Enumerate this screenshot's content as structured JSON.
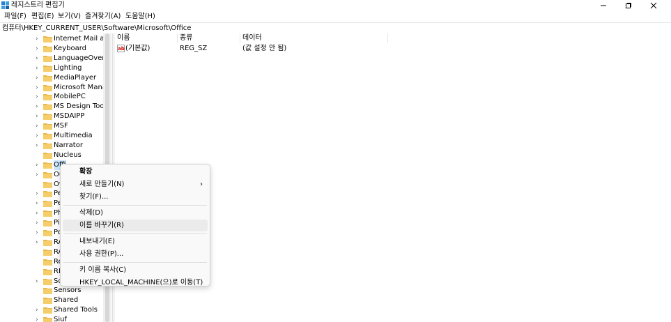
{
  "window": {
    "title": "레지스트리 편집기"
  },
  "menubar": [
    "파일(F)",
    "편집(E)",
    "보기(V)",
    "즐겨찾기(A)",
    "도움말(H)"
  ],
  "address": "컴퓨터\\HKEY_CURRENT_USER\\Software\\Microsoft\\Office",
  "tree": [
    {
      "label": "Internet Mail and",
      "expandable": true
    },
    {
      "label": "Keyboard",
      "expandable": true
    },
    {
      "label": "LanguageOverlay",
      "expandable": true
    },
    {
      "label": "Lighting",
      "expandable": true
    },
    {
      "label": "MediaPlayer",
      "expandable": true
    },
    {
      "label": "Microsoft Manage",
      "expandable": true
    },
    {
      "label": "MobilePC",
      "expandable": true
    },
    {
      "label": "MS Design Tools",
      "expandable": true
    },
    {
      "label": "MSDAIPP",
      "expandable": true
    },
    {
      "label": "MSF",
      "expandable": true
    },
    {
      "label": "Multimedia",
      "expandable": true
    },
    {
      "label": "Narrator",
      "expandable": true
    },
    {
      "label": "Nucleus",
      "expandable": false
    },
    {
      "label": "Offi",
      "expandable": true,
      "selected": true
    },
    {
      "label": "Ou",
      "expandable": true
    },
    {
      "label": "Ov",
      "expandable": false
    },
    {
      "label": "Pe",
      "expandable": true
    },
    {
      "label": "Pe",
      "expandable": true
    },
    {
      "label": "Ph",
      "expandable": true
    },
    {
      "label": "Pi",
      "expandable": true
    },
    {
      "label": "Po",
      "expandable": true
    },
    {
      "label": "RA",
      "expandable": true
    },
    {
      "label": "RA",
      "expandable": false
    },
    {
      "label": "Re",
      "expandable": false
    },
    {
      "label": "RF",
      "expandable": false
    },
    {
      "label": "Sc",
      "expandable": true
    },
    {
      "label": "Sensors",
      "expandable": false
    },
    {
      "label": "Shared",
      "expandable": false
    },
    {
      "label": "Shared Tools",
      "expandable": true
    },
    {
      "label": "Siuf",
      "expandable": true
    }
  ],
  "values_pane": {
    "headers": [
      "이름",
      "종류",
      "데이터"
    ],
    "rows": [
      {
        "icon": "ab",
        "name": "(기본값)",
        "type": "REG_SZ",
        "data": "(값 설정 안 됨)"
      }
    ]
  },
  "context_menu": {
    "items": [
      {
        "label": "확장",
        "bold": true
      },
      {
        "label": "새로 만들기(N)",
        "submenu": true
      },
      {
        "label": "찾기(F)..."
      },
      {
        "separator": true
      },
      {
        "label": "삭제(D)"
      },
      {
        "label": "이름 바꾸기(R)",
        "hover": true
      },
      {
        "separator": true
      },
      {
        "label": "내보내기(E)"
      },
      {
        "label": "사용 권한(P)..."
      },
      {
        "separator": true
      },
      {
        "label": "키 이름 복사(C)"
      },
      {
        "label": "HKEY_LOCAL_MACHINE(으)로 이동(T)"
      }
    ]
  },
  "colors": {
    "folder": "#e8b84a",
    "selection": "#cce8ff",
    "hover": "#ebebeb"
  }
}
